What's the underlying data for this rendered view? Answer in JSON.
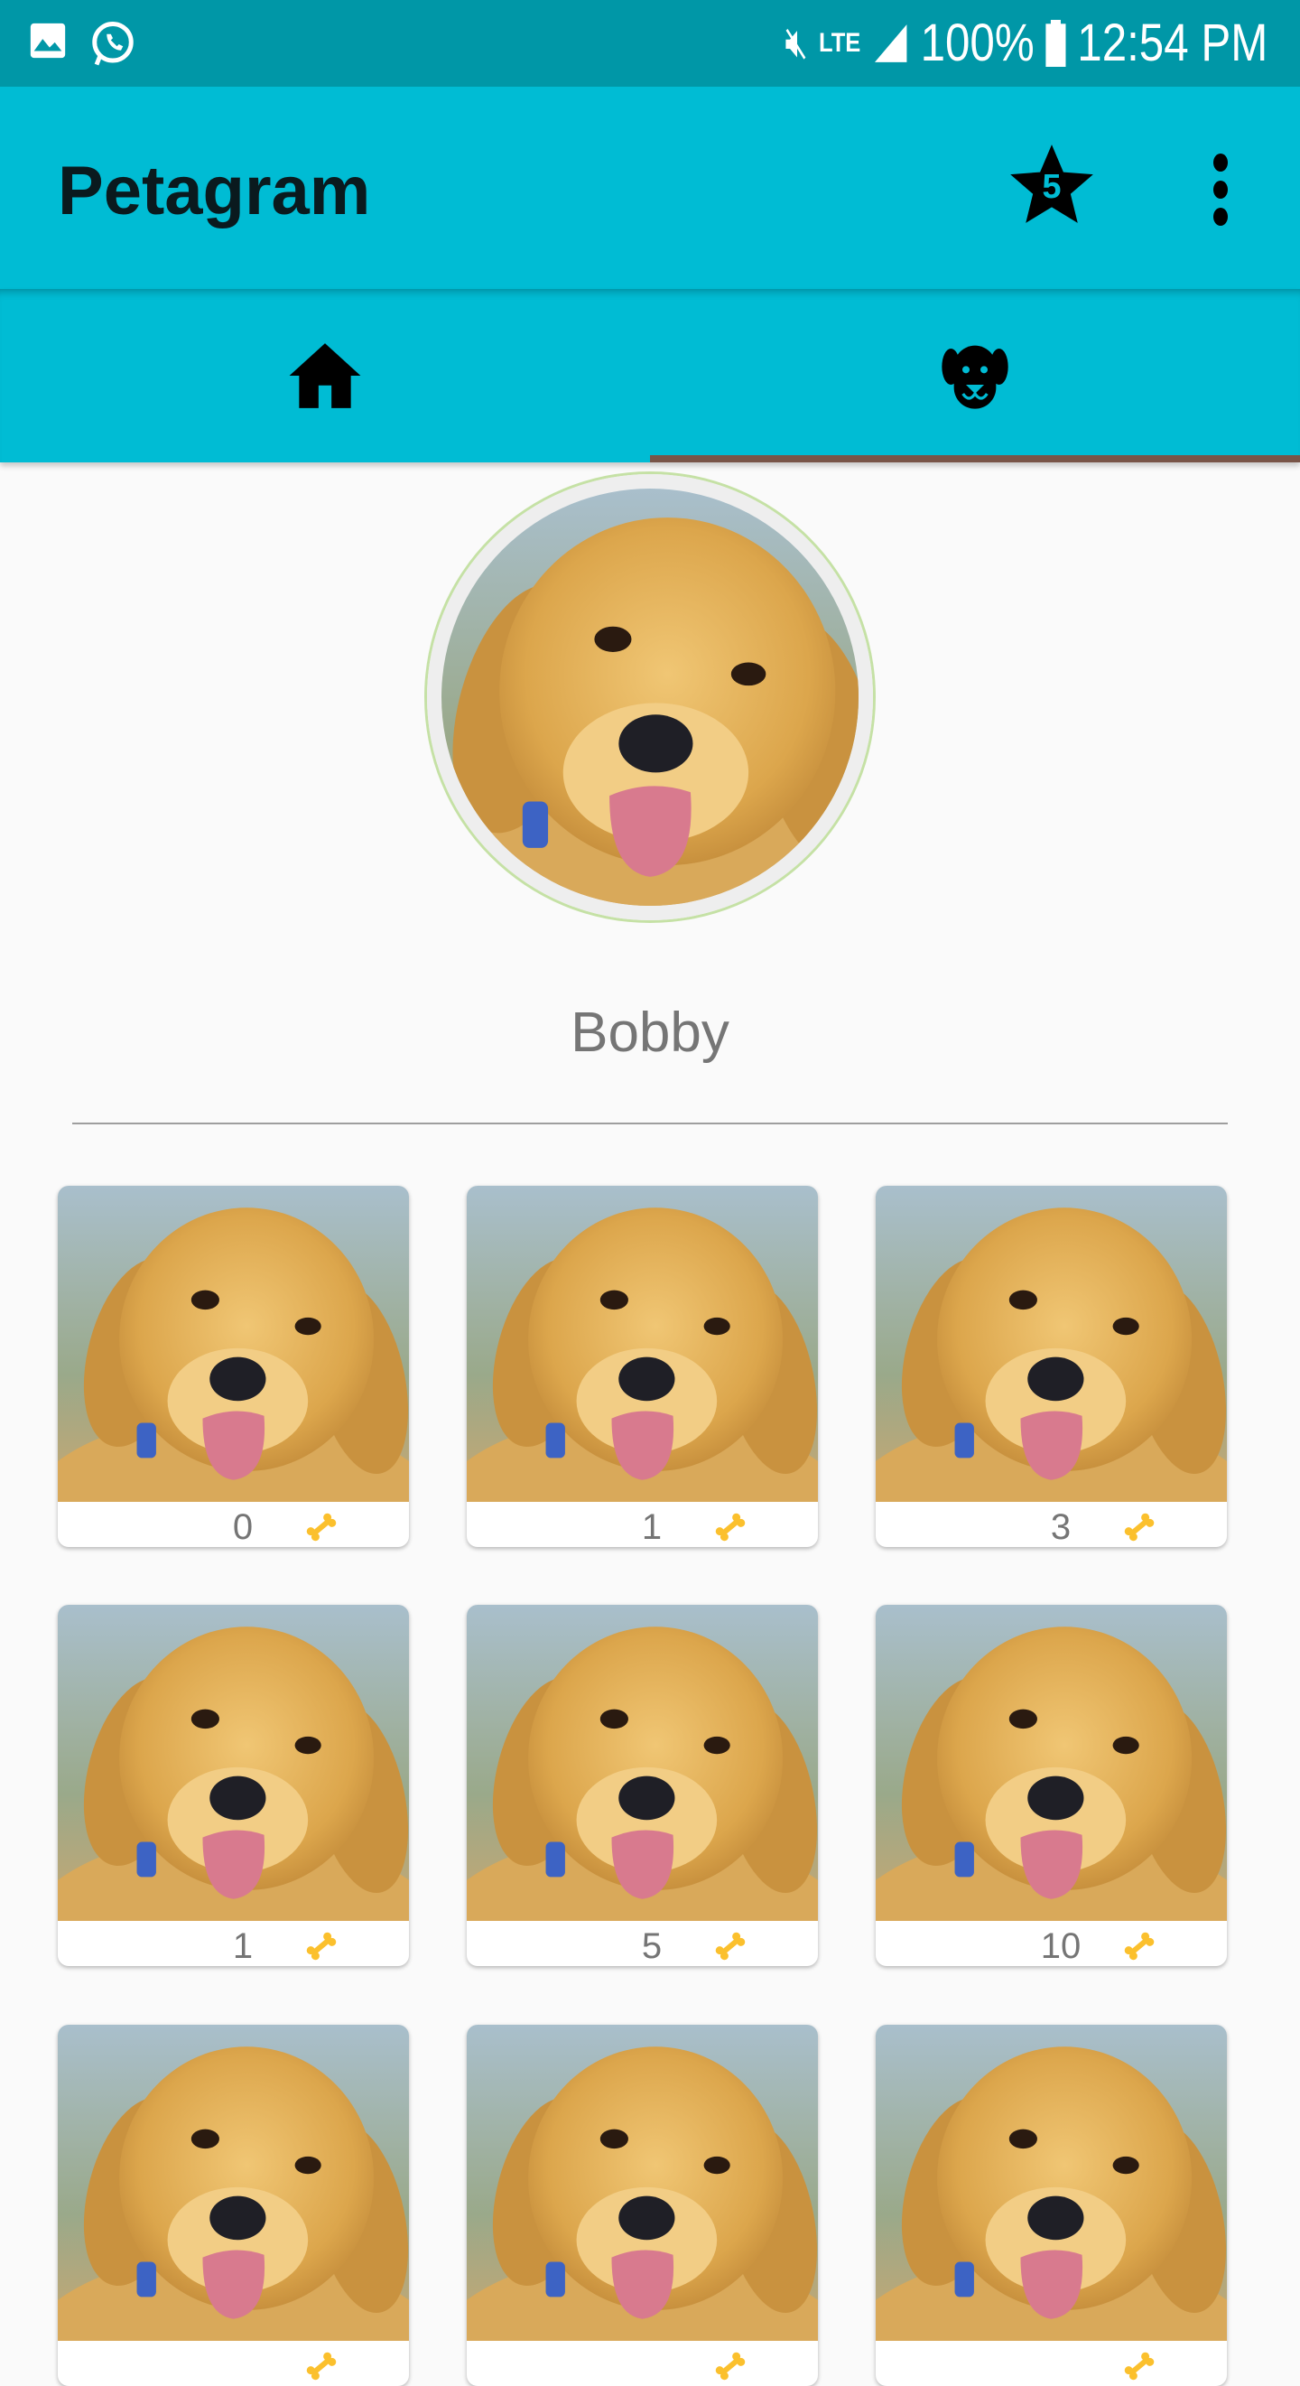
{
  "status_bar": {
    "battery": "100%",
    "time": "12:54 PM",
    "network": "LTE",
    "icons": [
      "gallery-icon",
      "whatsapp-icon",
      "mute-icon",
      "lte-icon",
      "signal-icon",
      "battery-icon"
    ]
  },
  "app_bar": {
    "title": "Petagram",
    "favorites_count": "5",
    "icons": [
      "star-icon",
      "more-vert-icon"
    ]
  },
  "tabs": [
    {
      "icon": "home-icon",
      "selected": false
    },
    {
      "icon": "dog-icon",
      "selected": true
    }
  ],
  "profile": {
    "name": "Bobby"
  },
  "colors": {
    "primary": "#00bcd4",
    "primary_dark": "#0097a7",
    "indicator": "#795548",
    "bone": "#fbc02d"
  },
  "photos": [
    {
      "likes": "0"
    },
    {
      "likes": "1"
    },
    {
      "likes": "3"
    },
    {
      "likes": "1"
    },
    {
      "likes": "5"
    },
    {
      "likes": "10"
    },
    {
      "likes": ""
    },
    {
      "likes": ""
    },
    {
      "likes": ""
    }
  ]
}
